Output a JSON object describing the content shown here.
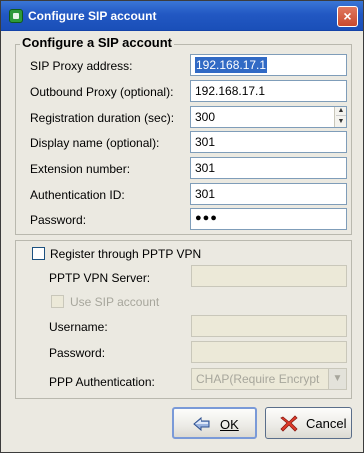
{
  "window": {
    "title": "Configure SIP account",
    "close_label": "×"
  },
  "account": {
    "group_title": "Configure a SIP account",
    "fields": [
      {
        "label": "SIP Proxy address:",
        "value": "192.168.17.1"
      },
      {
        "label": "Outbound Proxy (optional):",
        "value": "192.168.17.1"
      },
      {
        "label": "Registration duration (sec):",
        "value": "300"
      },
      {
        "label": "Display name (optional):",
        "value": "301"
      },
      {
        "label": "Extension number:",
        "value": "301"
      },
      {
        "label": "Authentication ID:",
        "value": "301"
      },
      {
        "label": "Password:",
        "value": "●●●"
      }
    ]
  },
  "vpn": {
    "register_label": "Register through PPTP VPN",
    "server_label": "PPTP VPN Server:",
    "use_sip_label": "Use SIP account",
    "username_label": "Username:",
    "password_label": "Password:",
    "auth_label": "PPP Authentication:",
    "auth_value": "CHAP(Require Encrypt"
  },
  "buttons": {
    "ok_label": "OK",
    "cancel_label": "Cancel"
  }
}
